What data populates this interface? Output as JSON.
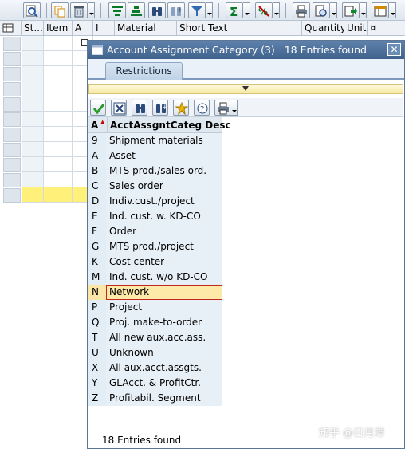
{
  "toolbar": {
    "buttons": [
      "find-icon",
      "copy-icon",
      "delete-icon",
      "align-top-icon",
      "align-icon",
      "binoculars-icon",
      "binoculars-next-icon",
      "filter-icon",
      "sum-icon",
      "subtotal-icon",
      "print-icon",
      "print-preview-icon",
      "export-icon",
      "layout-icon"
    ]
  },
  "table": {
    "columns": [
      "St...",
      "Item",
      "A",
      "I",
      "Material",
      "Short Text",
      "Quantity",
      "Unit",
      "¤"
    ]
  },
  "dialog": {
    "title": "Account Assignment Category (3)   18 Entries found",
    "close_label": "✕",
    "tab_label": "Restrictions",
    "col_key": "A",
    "col_desc": "AcctAssgntCateg Desc",
    "footer": "18 Entries found",
    "selected_index": 10,
    "rows": [
      {
        "key": "9",
        "desc": "Shipment materials"
      },
      {
        "key": "A",
        "desc": "Asset"
      },
      {
        "key": "B",
        "desc": "MTS prod./sales ord."
      },
      {
        "key": "C",
        "desc": "Sales order"
      },
      {
        "key": "D",
        "desc": "Indiv.cust./project"
      },
      {
        "key": "E",
        "desc": "Ind. cust. w. KD-CO"
      },
      {
        "key": "F",
        "desc": "Order"
      },
      {
        "key": "G",
        "desc": "MTS prod./project"
      },
      {
        "key": "K",
        "desc": "Cost center"
      },
      {
        "key": "M",
        "desc": "Ind. cust. w/o KD-CO"
      },
      {
        "key": "N",
        "desc": "Network"
      },
      {
        "key": "P",
        "desc": "Project"
      },
      {
        "key": "Q",
        "desc": "Proj. make-to-order"
      },
      {
        "key": "T",
        "desc": "All new aux.acc.ass."
      },
      {
        "key": "U",
        "desc": "Unknown"
      },
      {
        "key": "X",
        "desc": "All aux.acct.assgts."
      },
      {
        "key": "Y",
        "desc": "GLAcct. & ProfitCtr."
      },
      {
        "key": "Z",
        "desc": "Profitabil. Segment"
      }
    ]
  },
  "watermark": "知乎 @日月潭",
  "colors": {
    "title_bar": "#4a6e98",
    "selected_row": "#fde9a8",
    "selected_border": "#c2271f",
    "highlight_row": "#fff07a"
  }
}
